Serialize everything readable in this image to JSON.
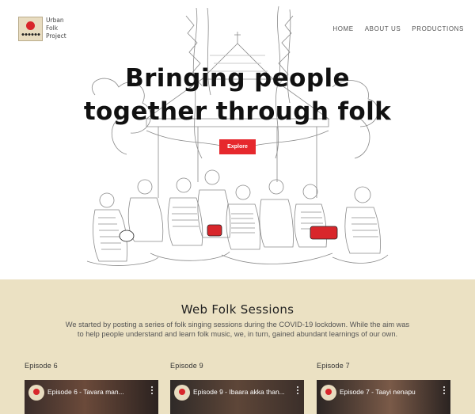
{
  "brand": {
    "logo_lines": [
      "Urban",
      "Folk",
      "Project"
    ],
    "accent_color": "#e6282d",
    "cream_color": "#ebe1c3"
  },
  "nav": {
    "items": [
      {
        "label": "HOME"
      },
      {
        "label": "ABOUT US"
      },
      {
        "label": "PRODUCTIONS"
      }
    ]
  },
  "hero": {
    "title_line1": "Bringing people",
    "title_line2": "together through folk",
    "cta_label": "Explore",
    "illustration": "folk-singers-under-bandstand-sketch"
  },
  "sessions": {
    "heading": "Web Folk Sessions",
    "intro": "We started by posting a series of folk singing sessions during the COVID-19 lockdown. While the aim was to help people understand and learn folk music, we, in turn, gained abundant learnings of our own.",
    "episodes": [
      {
        "label": "Episode 6",
        "video_title": "Episode 6 - Tavara man..."
      },
      {
        "label": "Episode 9",
        "video_title": "Episode 9 - Ibaara akka than..."
      },
      {
        "label": "Episode 7",
        "video_title": "Episode 7 - Taayi nenapu"
      }
    ]
  }
}
